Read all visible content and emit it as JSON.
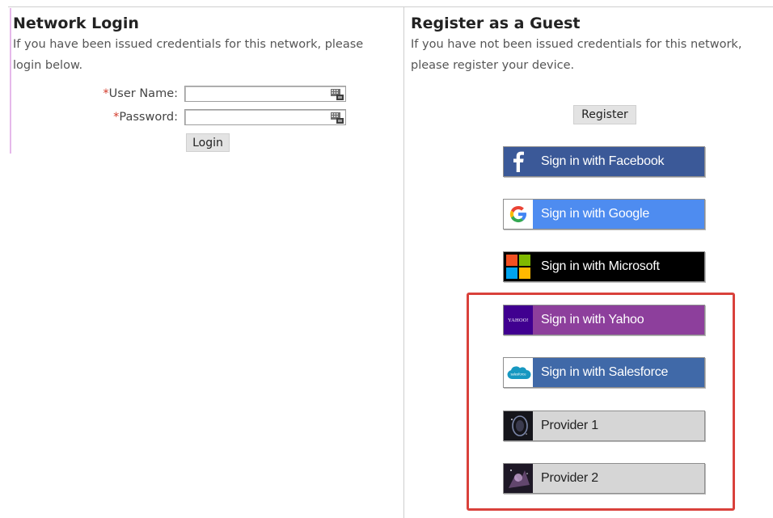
{
  "network_login": {
    "title": "Network Login",
    "description_line1": "If you have been issued credentials for this network, please",
    "description_line2": "login below.",
    "username_label": "User Name:",
    "password_label": "Password:",
    "required_marker": "*",
    "username_value": "",
    "password_value": "",
    "login_button": "Login"
  },
  "guest": {
    "title": "Register as a Guest",
    "description_line1": "If you have not been issued credentials for this network,",
    "description_line2": "please register your device.",
    "register_button": "Register",
    "providers": [
      {
        "label": "Sign in with Facebook",
        "icon": "facebook-icon",
        "color": "#3b5998"
      },
      {
        "label": "Sign in with Google",
        "icon": "google-icon",
        "color": "#4e8cf0"
      },
      {
        "label": "Sign in with Microsoft",
        "icon": "microsoft-icon",
        "color": "#000000"
      },
      {
        "label": "Sign in with Yahoo",
        "icon": "yahoo-icon",
        "color": "#8d3f9c",
        "logo_text": "YAHOO!"
      },
      {
        "label": "Sign in with Salesforce",
        "icon": "salesforce-icon",
        "color": "#4069a8",
        "logo_text": "salesforce"
      },
      {
        "label": "Provider 1",
        "icon": "provider-1-icon",
        "color": "#d6d6d6"
      },
      {
        "label": "Provider 2",
        "icon": "provider-2-icon",
        "color": "#d6d6d6"
      }
    ],
    "highlight_color": "#d9413b"
  }
}
